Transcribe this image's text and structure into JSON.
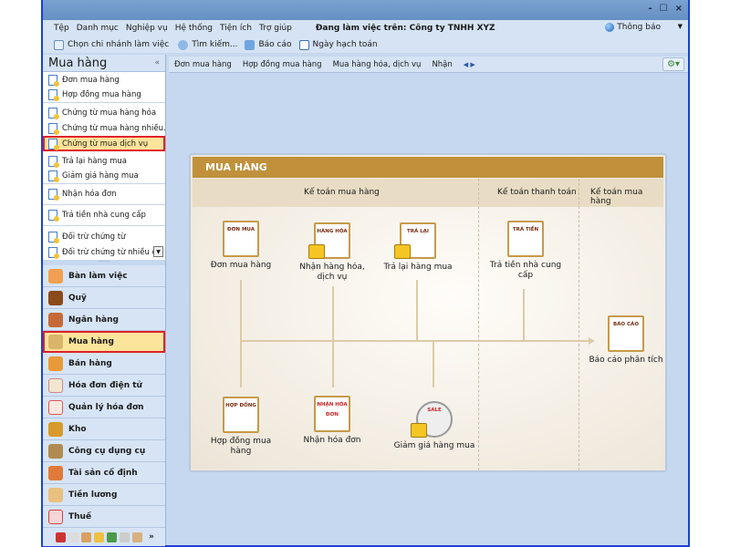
{
  "window": {
    "controls": [
      "-",
      "☐",
      "×"
    ]
  },
  "menu": {
    "items": [
      "Tệp",
      "Danh mục",
      "Nghiệp vụ",
      "Hệ thống",
      "Tiện ích",
      "Trợ giúp"
    ],
    "working_on": "Đang làm việc trên: Công ty TNHH XYZ",
    "notify": "Thông báo"
  },
  "toolbar": {
    "items": [
      "Chọn chi nhánh làm việc",
      "Tìm kiếm...",
      "Báo cáo",
      "Ngày hạch toán"
    ]
  },
  "sidebar": {
    "title": "Mua hàng",
    "collapse": "«",
    "items": [
      "Đơn mua hàng",
      "Hợp đồng mua hàng",
      "Chứng từ mua hàng hóa",
      "Chứng từ mua hàng nhiều...",
      "Chứng từ mua dịch vụ",
      "Trả lại hàng mua",
      "Giảm giá hàng mua",
      "Nhận hóa đơn",
      "Trả tiền nhà cung cấp",
      "Đối trừ chứng từ",
      "Đối trừ chứng từ nhiều đối"
    ],
    "selected": "Chứng từ mua dịch vụ"
  },
  "nav": {
    "items": [
      "Bàn làm việc",
      "Quỹ",
      "Ngân hàng",
      "Mua hàng",
      "Bán hàng",
      "Hóa đơn điện tử",
      "Quản lý hóa đơn",
      "Kho",
      "Công cụ dụng cụ",
      "Tài sản cố định",
      "Tiền lương",
      "Thuế"
    ],
    "selected": "Mua hàng",
    "more": "»"
  },
  "tabs": {
    "items": [
      "Đơn mua hàng",
      "Hợp đồng mua hàng",
      "Mua hàng hóa, dịch vụ",
      "Nhận"
    ]
  },
  "diagram": {
    "title": "MUA HÀNG",
    "sections": [
      "Kế toán mua hàng",
      "Kế toán thanh toán",
      "Kế toán mua hàng"
    ],
    "nodes": [
      {
        "label": "Đơn mua hàng",
        "icon": "ĐƠN MUA"
      },
      {
        "label": "Nhận hàng hóa, dịch vụ",
        "icon": "HÀNG HÓA"
      },
      {
        "label": "Trả lại hàng mua",
        "icon": "TRẢ LẠI"
      },
      {
        "label": "Trả tiền nhà cung cấp",
        "icon": "TRẢ TIỀN"
      },
      {
        "label": "Báo cáo phân tích",
        "icon": "BÁO CÁO"
      },
      {
        "label": "Hợp đồng mua hàng",
        "icon": "HỢP ĐỒNG"
      },
      {
        "label": "Nhận hóa đơn",
        "icon": "NHẬN HÓA ĐƠN"
      },
      {
        "label": "Giảm giá hàng mua",
        "icon": "SALE"
      }
    ]
  },
  "colors": {
    "accent": "#c0913a",
    "selection": "#fde49b",
    "highlight_border": "#e0202a",
    "window_border": "#1e3fd6"
  }
}
